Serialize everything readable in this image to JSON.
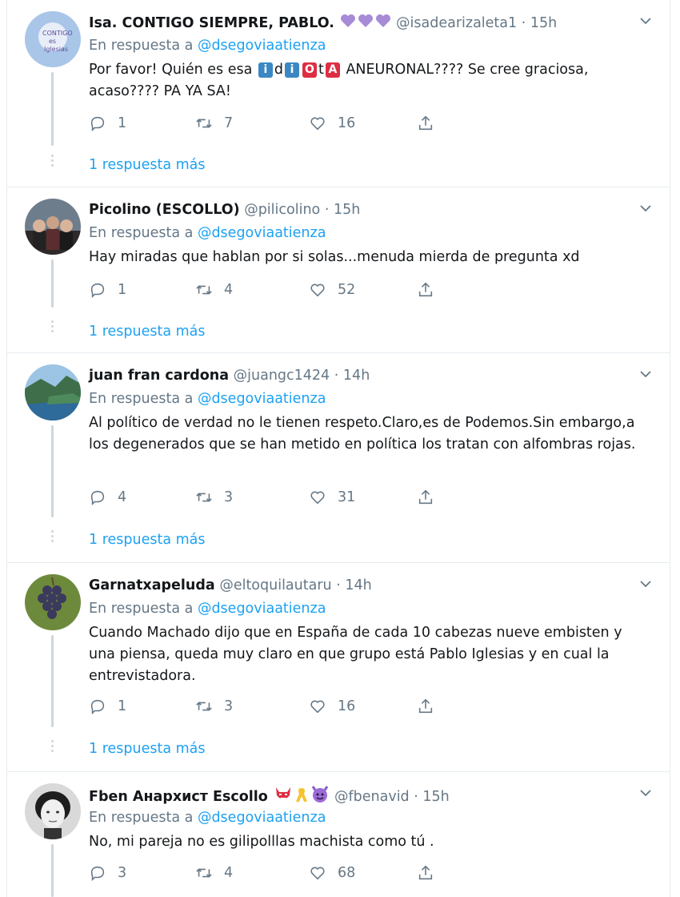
{
  "reply_prefix": "En respuesta a",
  "more_label": "1 respuesta más",
  "tweets": [
    {
      "name": "Isa. CONTIGO SIEMPRE, PABLO.",
      "name_emoji": [
        "purple-heart",
        "purple-heart",
        "purple-heart"
      ],
      "handle": "@isadearizaleta1",
      "sep": "·",
      "time": "15h",
      "mention": "@dsegoviaatienza",
      "text_parts": {
        "p1": "Por favor! Quién es esa ",
        "i1": "i",
        "d": "d",
        "i2": "i",
        "o": "O",
        "t": "t",
        "a": "A",
        "p2": " ANEURONAL???? Se cree graciosa, acaso???? PA YA SA!"
      },
      "replies": "1",
      "retweets": "7",
      "likes": "16"
    },
    {
      "name": "Picolino (ESCOLLO)",
      "handle": "@pilicolino",
      "sep": "·",
      "time": "15h",
      "mention": "@dsegoviaatienza",
      "text": "Hay miradas que hablan por si solas...menuda mierda de pregunta xd",
      "replies": "1",
      "retweets": "4",
      "likes": "52"
    },
    {
      "name": "juan fran cardona",
      "handle": "@juangc1424",
      "sep": "·",
      "time": "14h",
      "mention": "@dsegoviaatienza",
      "text": "Al político de verdad no le tienen respeto.Claro,es de Podemos.Sin embargo,a los degenerados que se han metido en política los tratan con alfombras rojas.",
      "replies": "4",
      "retweets": "3",
      "likes": "31"
    },
    {
      "name": "Garnatxapeluda",
      "handle": "@eltoquilautaru",
      "sep": "·",
      "time": "14h",
      "mention": "@dsegoviaatienza",
      "text": "Cuando Machado dijo que en España de cada 10 cabezas nueve embisten y una piensa, queda muy claro en que grupo está Pablo Iglesias y en cual la entrevistadora.",
      "replies": "1",
      "retweets": "3",
      "likes": "16"
    },
    {
      "name": "Fben Анархист Escollo",
      "name_emoji": [
        "ogre-face",
        "yellow-ribbon",
        "purple-devil"
      ],
      "handle": "@fbenavid",
      "sep": "·",
      "time": "15h",
      "mention": "@dsegoviaatienza",
      "text": "No, mi pareja no es gilipolllas machista como tú .",
      "replies": "3",
      "retweets": "4",
      "likes": "68"
    }
  ],
  "colors": {
    "link": "#1da1f2",
    "muted": "#657786",
    "line": "#ccd6dd",
    "heart": "#a78bd6"
  }
}
